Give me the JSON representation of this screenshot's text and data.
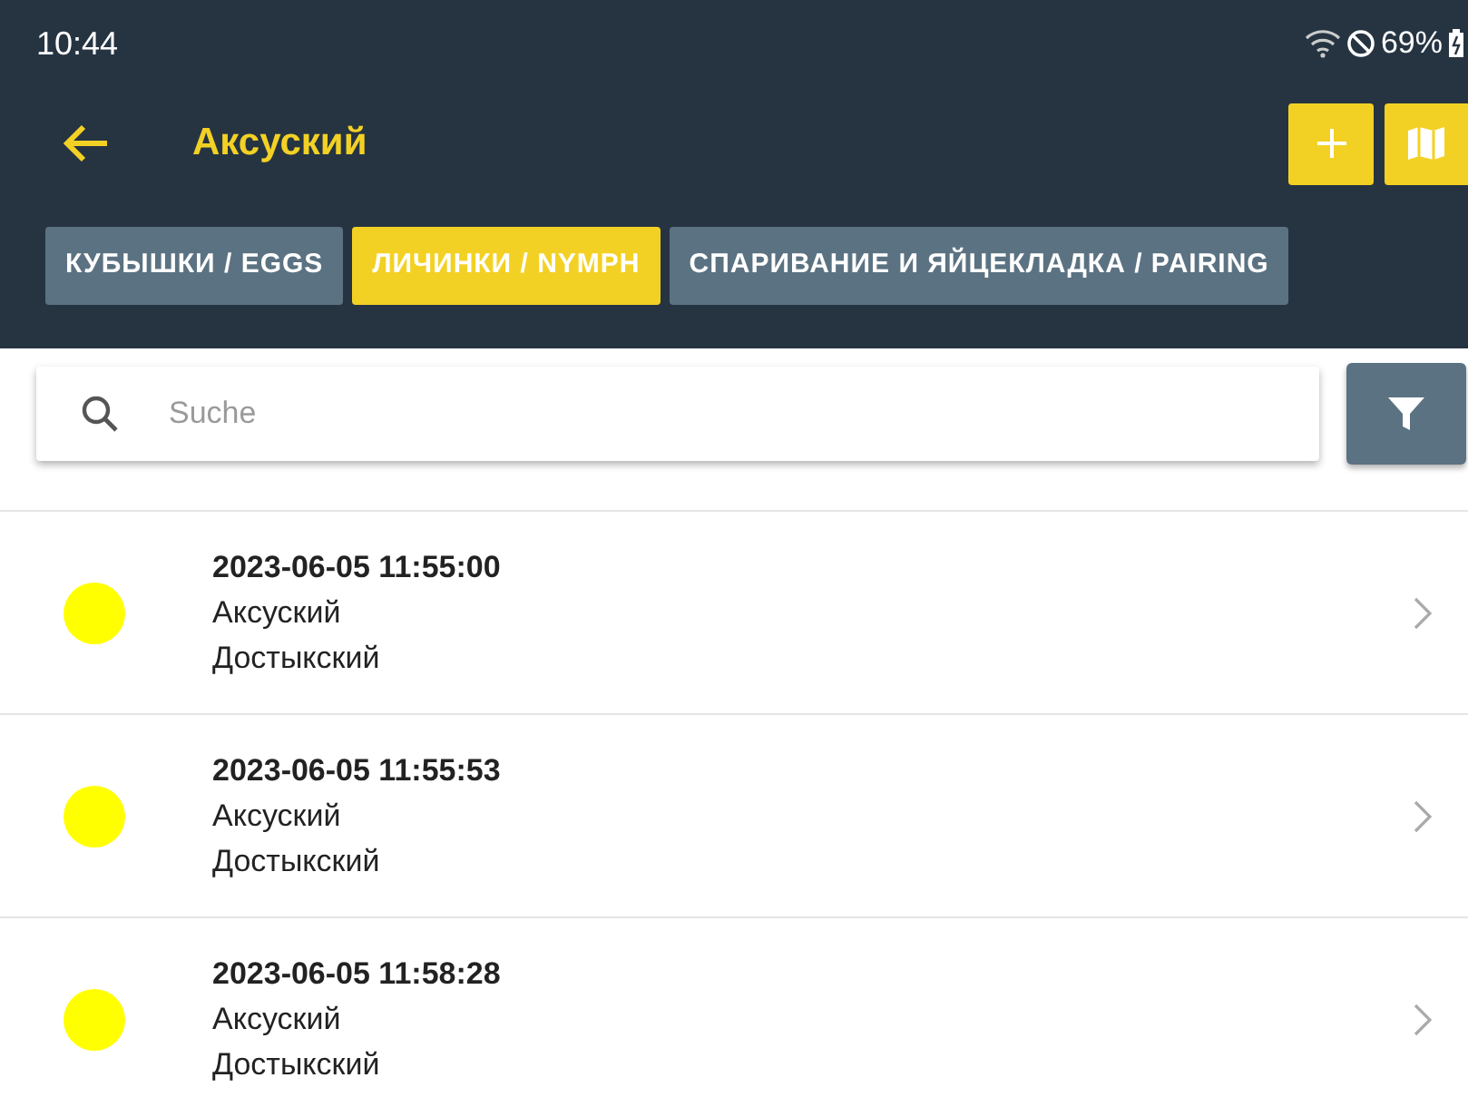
{
  "status_bar": {
    "time": "10:44",
    "battery": "69%"
  },
  "header": {
    "title": "Аксуский"
  },
  "tabs": [
    {
      "label": "КУБЫШКИ / EGGS",
      "selected": false
    },
    {
      "label": "ЛИЧИНКИ / NYMPH",
      "selected": true
    },
    {
      "label": "СПАРИВАНИЕ И ЯЙЦЕКЛАДКА / PAIRING",
      "selected": false
    }
  ],
  "search": {
    "placeholder": "Suche"
  },
  "records": [
    {
      "datetime": "2023-06-05 11:55:00",
      "district": "Аксуский",
      "subdistrict": "Достыкский",
      "color": "#ffff00"
    },
    {
      "datetime": "2023-06-05 11:55:53",
      "district": "Аксуский",
      "subdistrict": "Достыкский",
      "color": "#ffff00"
    },
    {
      "datetime": "2023-06-05 11:58:28",
      "district": "Аксуский",
      "subdistrict": "Достыкский",
      "color": "#ffff00"
    }
  ]
}
